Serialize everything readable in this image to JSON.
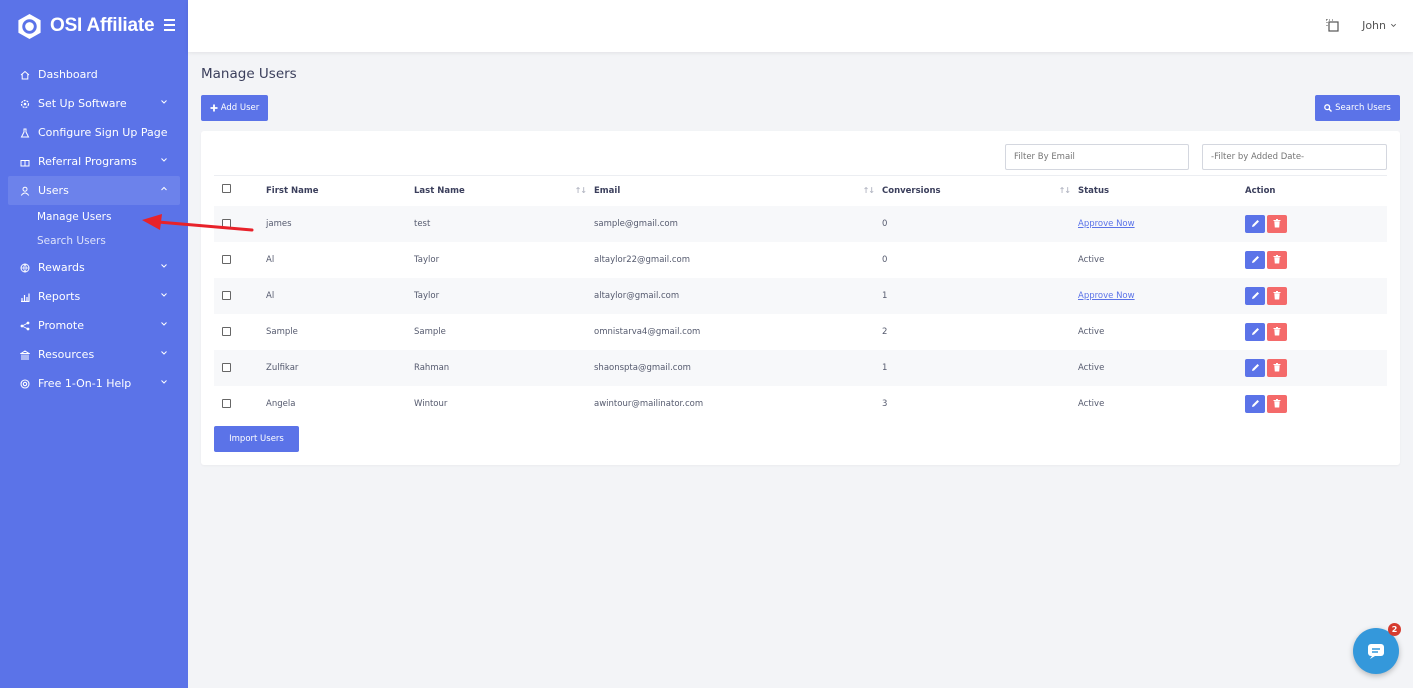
{
  "app": {
    "brand": "OSI Affiliate"
  },
  "header": {
    "user_name": "John"
  },
  "sidebar": {
    "items": [
      {
        "label": "Dashboard",
        "icon": "home-icon",
        "has_chevron": false
      },
      {
        "label": "Set Up Software",
        "icon": "gear-icon",
        "has_chevron": true
      },
      {
        "label": "Configure Sign Up Page",
        "icon": "flask-icon",
        "has_chevron": false
      },
      {
        "label": "Referral Programs",
        "icon": "gift-icon",
        "has_chevron": true
      },
      {
        "label": "Users",
        "icon": "user-icon",
        "has_chevron": true,
        "expanded": true
      },
      {
        "label": "Rewards",
        "icon": "globe-icon",
        "has_chevron": true
      },
      {
        "label": "Reports",
        "icon": "bar-chart-icon",
        "has_chevron": true
      },
      {
        "label": "Promote",
        "icon": "share-icon",
        "has_chevron": true
      },
      {
        "label": "Resources",
        "icon": "bank-icon",
        "has_chevron": true
      },
      {
        "label": "Free 1-On-1 Help",
        "icon": "lifebuoy-icon",
        "has_chevron": true
      }
    ],
    "users_sub": [
      {
        "label": "Manage Users"
      },
      {
        "label": "Search Users"
      }
    ]
  },
  "main": {
    "title": "Manage Users",
    "add_user_label": "Add User",
    "search_users_label": "Search Users",
    "import_users_label": "Import Users",
    "filter_email_placeholder": "Filter By Email",
    "filter_date_placeholder": "-Filter by Added Date-"
  },
  "table": {
    "columns": [
      "First Name",
      "Last Name",
      "Email",
      "Conversions",
      "Status",
      "Action"
    ],
    "rows": [
      {
        "first": "james",
        "last": "test",
        "email": "sample@gmail.com",
        "conversions": "0",
        "status": "Approve Now"
      },
      {
        "first": "Al",
        "last": "Taylor",
        "email": "altaylor22@gmail.com",
        "conversions": "0",
        "status": "Active"
      },
      {
        "first": "Al",
        "last": "Taylor",
        "email": "altaylor@gmail.com",
        "conversions": "1",
        "status": "Approve Now"
      },
      {
        "first": "Sample",
        "last": "Sample",
        "email": "omnistarva4@gmail.com",
        "conversions": "2",
        "status": "Active"
      },
      {
        "first": "Zulfikar",
        "last": "Rahman",
        "email": "shaonspta@gmail.com",
        "conversions": "1",
        "status": "Active"
      },
      {
        "first": "Angela",
        "last": "Wintour",
        "email": "awintour@mailinator.com",
        "conversions": "3",
        "status": "Active"
      }
    ]
  },
  "chat": {
    "badge_count": "2"
  },
  "colors": {
    "primary": "#5b73e8",
    "danger": "#f46a6a",
    "chat": "#3498db",
    "annotation": "#e8222a"
  }
}
